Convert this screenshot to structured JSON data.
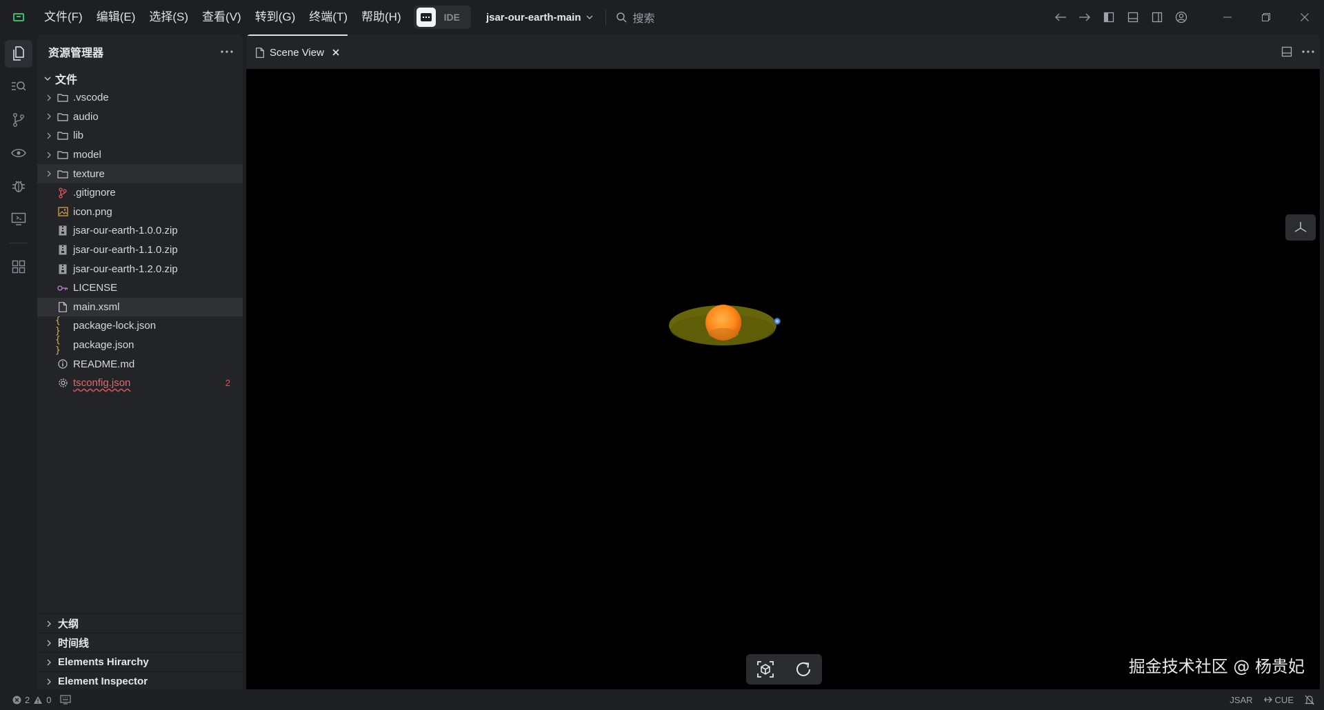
{
  "menu": {
    "items": [
      "文件(F)",
      "编辑(E)",
      "选择(S)",
      "查看(V)",
      "转到(G)",
      "终端(T)",
      "帮助(H)"
    ],
    "ide_label": "IDE",
    "project": "jsar-our-earth-main",
    "search_label": "搜索"
  },
  "sidebar": {
    "title": "资源管理器",
    "section": "文件",
    "items": [
      {
        "label": ".vscode",
        "type": "folder"
      },
      {
        "label": "audio",
        "type": "folder"
      },
      {
        "label": "lib",
        "type": "folder"
      },
      {
        "label": "model",
        "type": "folder"
      },
      {
        "label": "texture",
        "type": "folder"
      },
      {
        "label": ".gitignore",
        "type": "git"
      },
      {
        "label": "icon.png",
        "type": "image"
      },
      {
        "label": "jsar-our-earth-1.0.0.zip",
        "type": "zip"
      },
      {
        "label": "jsar-our-earth-1.1.0.zip",
        "type": "zip"
      },
      {
        "label": "jsar-our-earth-1.2.0.zip",
        "type": "zip"
      },
      {
        "label": "LICENSE",
        "type": "license"
      },
      {
        "label": "main.xsml",
        "type": "file"
      },
      {
        "label": "package-lock.json",
        "type": "json"
      },
      {
        "label": "package.json",
        "type": "json"
      },
      {
        "label": "README.md",
        "type": "info"
      },
      {
        "label": "tsconfig.json",
        "type": "gear",
        "badge": "2"
      }
    ],
    "bottom_sections": [
      "大纲",
      "时间线",
      "Elements Hirarchy",
      "Element Inspector"
    ]
  },
  "editor": {
    "tab_label": "Scene View",
    "watermark": "掘金技术社区 @ 杨贵妃"
  },
  "status": {
    "errors": "2",
    "warnings": "0",
    "right_items": [
      "JSAR",
      "CUE"
    ]
  },
  "colors": {
    "accent_green": "#2fbf71",
    "error": "#e0555f",
    "sun": "#ff8a1c",
    "orbit": "#6b6a0a"
  }
}
